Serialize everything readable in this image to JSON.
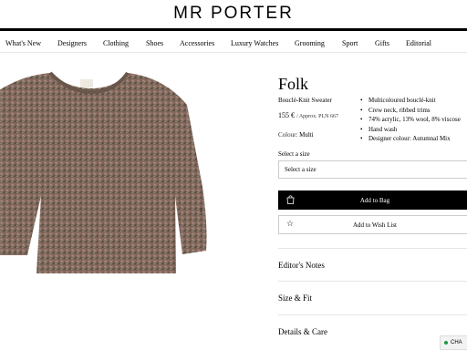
{
  "header": {
    "logo": "MR PORTER"
  },
  "nav": {
    "items": [
      "What's New",
      "Designers",
      "Clothing",
      "Shoes",
      "Accessories",
      "Luxury Watches",
      "Grooming",
      "Sport",
      "Gifts",
      "Editorial"
    ]
  },
  "product": {
    "brand": "Folk",
    "name": "Bouclé-Knit Sweater",
    "price": "155 €",
    "approx_price": "/ Approx. PLN 667",
    "colour_label": "Colour:",
    "colour_value": "Multi",
    "details": [
      "Multicoloured bouclé-knit",
      "Crew neck, ribbed trims",
      "74% acrylic, 13% wool, 8% viscose",
      "Hand wash",
      "Designer colour: Autumnal Mix"
    ]
  },
  "size": {
    "label": "Select a size",
    "placeholder": "Select a size"
  },
  "actions": {
    "add_to_bag": "Add to Bag",
    "add_to_wishlist": "Add to Wish List"
  },
  "sections": [
    "Editor's Notes",
    "Size & Fit",
    "Details & Care"
  ],
  "chat": {
    "label": "CHA"
  },
  "colors": {
    "accent": "#000000",
    "chat_status": "#1a9c3e"
  }
}
